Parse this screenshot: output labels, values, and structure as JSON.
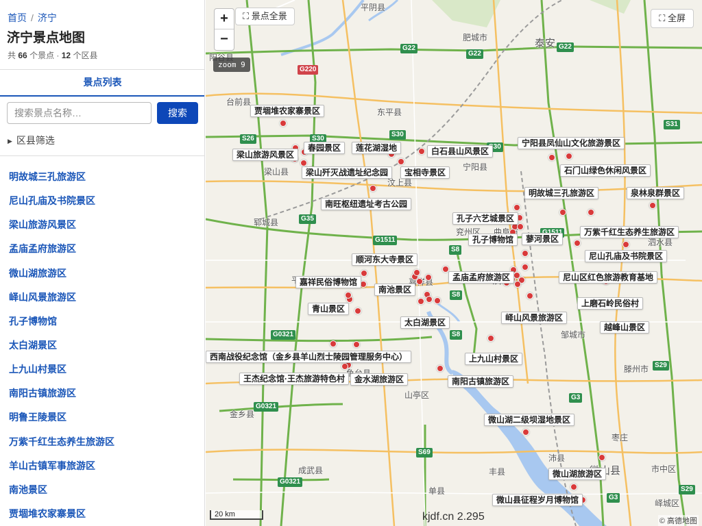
{
  "breadcrumb": {
    "home": "首页",
    "separator": "/",
    "current": "济宁"
  },
  "title": "济宁景点地图",
  "stats": {
    "prefix": "共",
    "spots": "66",
    "spots_unit": "个景点 ·",
    "districts": "12",
    "districts_unit": "个区县"
  },
  "tab_label": "景点列表",
  "search": {
    "placeholder": "搜索景点名称…",
    "button": "搜索"
  },
  "filter_label": "区县筛选",
  "spot_list": [
    "明故城三孔旅游区",
    "尼山孔庙及书院景区",
    "梁山旅游风景区",
    "孟庙孟府旅游区",
    "微山湖旅游区",
    "峄山风景旅游区",
    "孔子博物馆",
    "太白湖景区",
    "上九山村景区",
    "南阳古镇旅游区",
    "明鲁王陵景区",
    "万紫千红生态养生旅游区",
    "羊山古镇军事旅游区",
    "南池景区",
    "贾堌堆农家寨景区"
  ],
  "map": {
    "zoom_in": "+",
    "zoom_out": "−",
    "zoom_badge": "zoom 9",
    "overview_btn": "⛶ 景点全景",
    "fullscreen_btn": "⛶ 全屏",
    "scale": "20 km",
    "watermark": "kjdf.cn 2.295",
    "attribution": "© 高德地图",
    "place_labels": [
      "平阴县",
      "肥城市",
      "泰安",
      "阳谷县",
      "台前县",
      "东平县",
      "宁阳县",
      "汶上县",
      "梁山县",
      "郓城县",
      "兖州区",
      "曲阜市",
      "泗水县",
      "平邑县",
      "巨野县",
      "嘉祥县",
      "济宁",
      "邹城市",
      "滕州市",
      "山亭区",
      "鱼台县",
      "金乡县",
      "成武县",
      "单县",
      "丰县",
      "沛县",
      "微山县",
      "枣庄",
      "市中区",
      "峄城区",
      "台儿庄区"
    ],
    "road_labels": [
      "G22",
      "G22",
      "G22",
      "G220",
      "S30",
      "S30",
      "S30",
      "S26",
      "S31",
      "G35",
      "G1511",
      "G1511",
      "S8",
      "S8",
      "S8",
      "G0321",
      "G0321",
      "G0321",
      "S69",
      "G3",
      "G3",
      "S29",
      "S29",
      "S38"
    ],
    "spot_labels": [
      "贾堌堆农家寨景区",
      "春园景区",
      "莲花湖湿地",
      "白石县山风景区",
      "宁阳县凤仙山文化旅游景区",
      "梁山旅游风景区",
      "梁山歼灭战遗址纪念园",
      "宝相寺景区",
      "石门山绿色休闲风景区",
      "南旺枢纽遗址考古公园",
      "明故城三孔旅游区",
      "泉林泉群景区",
      "孔子六艺城景区",
      "孔子博物馆",
      "蓼河景区",
      "万紫千红生态养生旅游区",
      "顺河东大寺景区",
      "尼山孔庙及书院景区",
      "嘉祥民俗博物馆",
      "南池景区",
      "孟庙孟府旅游区",
      "尼山区红色旅游教育基地",
      "青山景区",
      "上磨石岭民俗村",
      "太白湖景区",
      "峄山风景旅游区",
      "越峰山景区",
      "西南战役纪念馆（金乡县羊山烈士陵园管理服务中心）",
      "上九山村景区",
      "王杰纪念馆·王杰旅游特色村",
      "金水湖旅游区",
      "南阳古镇旅游区",
      "微山湖二级坝湿地景区",
      "微山湖旅游区",
      "微山县征程岁月博物馆"
    ],
    "colors": {
      "expressway": "#6fb24b",
      "highway": "#f5c062",
      "water": "#a8c8f0",
      "pin": "#d93a3a",
      "accent": "#1a56b8"
    }
  }
}
